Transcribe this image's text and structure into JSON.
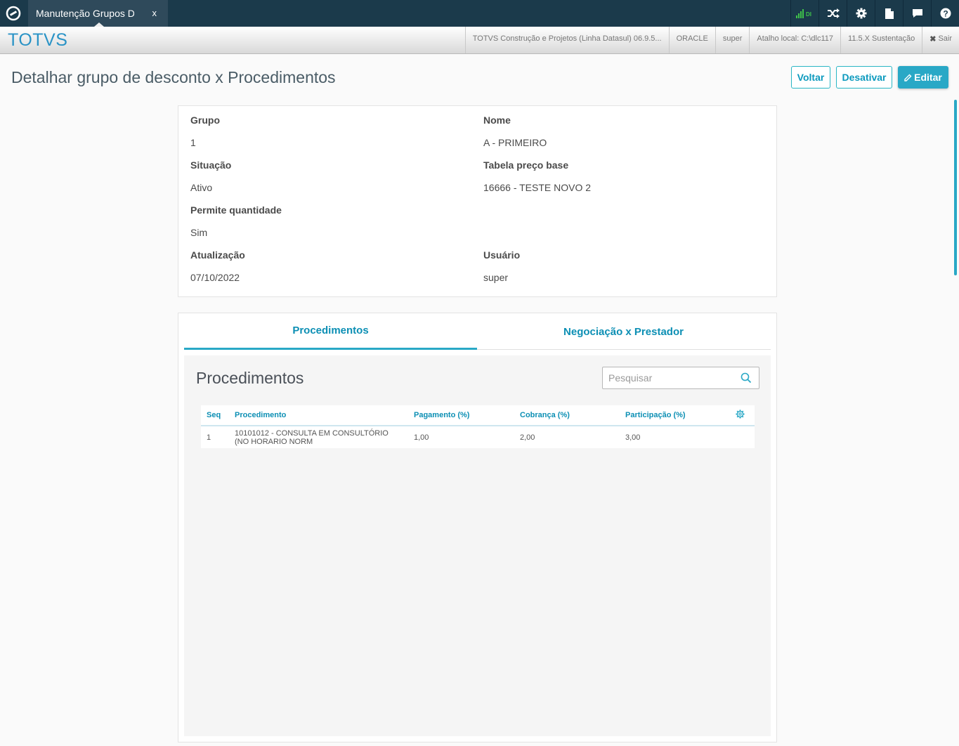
{
  "topbar": {
    "tab_title": "Manutenção Grupos D",
    "tab_close": "x",
    "signal_label": "DI",
    "accent": "#1b3a4b"
  },
  "subbar": {
    "brand": "TOTVS",
    "items": [
      "TOTVS Construção e Projetos (Linha Datasul) 06.9.5...",
      "ORACLE",
      "super",
      "Atalho local: C:\\dlc117",
      "11.5.X Sustentação"
    ],
    "logout_label": "Sair"
  },
  "header": {
    "title": "Detalhar grupo de desconto x Procedimentos",
    "back_label": "Voltar",
    "deactivate_label": "Desativar",
    "edit_label": "Editar"
  },
  "details": {
    "grupo_label": "Grupo",
    "grupo_value": "1",
    "nome_label": "Nome",
    "nome_value": "A - PRIMEIRO",
    "situacao_label": "Situação",
    "situacao_value": "Ativo",
    "tabela_label": "Tabela preço base",
    "tabela_value": "16666 - TESTE NOVO 2",
    "permite_label": "Permite quantidade",
    "permite_value": "Sim",
    "atualizacao_label": "Atualização",
    "atualizacao_value": "07/10/2022",
    "usuario_label": "Usuário",
    "usuario_value": "super"
  },
  "tabs": [
    "Procedimentos",
    "Negociação x Prestador"
  ],
  "procedimentos": {
    "title": "Procedimentos",
    "search_placeholder": "Pesquisar",
    "columns": [
      "Seq",
      "Procedimento",
      "Pagamento (%)",
      "Cobrança (%)",
      "Participação (%)"
    ],
    "rows": [
      {
        "seq": "1",
        "procedimento_line1": "10101012 - CONSULTA EM CONSULTÓRIO",
        "procedimento_line2": "(NO HORARIO NORM",
        "pagamento": "1,00",
        "cobranca": "2,00",
        "participacao": "3,00"
      }
    ]
  }
}
